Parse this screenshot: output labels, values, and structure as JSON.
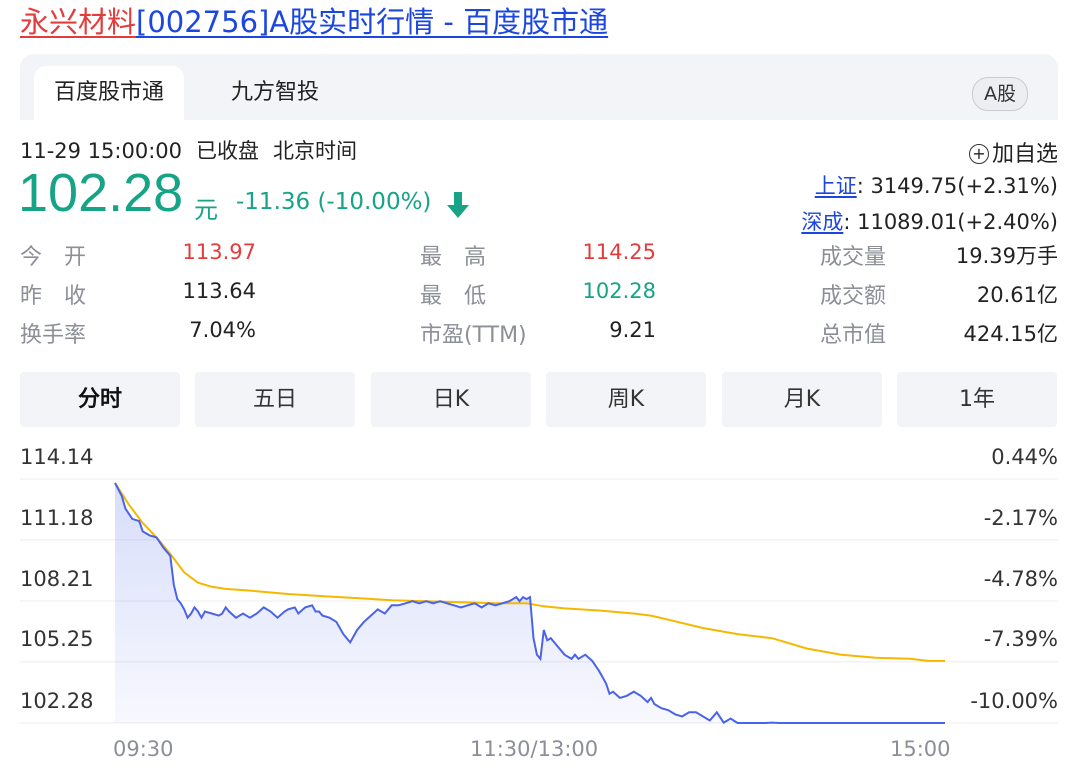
{
  "header": {
    "stock_name": "永兴材料",
    "code_title": "[002756]A股实时行情 - 百度股市通"
  },
  "tabs": {
    "items": [
      "百度股市通",
      "九方智投"
    ],
    "badge": "A股"
  },
  "quote": {
    "time": "11-29 15:00:00",
    "status": "已收盘",
    "timezone": "北京时间",
    "price": "102.28",
    "unit": "元",
    "change": "-11.36 (-10.00%)",
    "watch_label": "加自选",
    "watch_symbol": "+",
    "index_sh": {
      "name": "上证",
      "value": ": 3149.75(+2.31%)"
    },
    "index_sz": {
      "name": "深成",
      "value": ": 11089.01(+2.40%)"
    }
  },
  "stats": [
    {
      "label": "今　开",
      "value": "113.97",
      "color": "red"
    },
    {
      "label": "最　高",
      "value": "114.25",
      "color": "red"
    },
    {
      "label": "成交量",
      "value": "19.39万手",
      "color": ""
    },
    {
      "label": "昨　收",
      "value": "113.64",
      "color": ""
    },
    {
      "label": "最　低",
      "value": "102.28",
      "color": "green"
    },
    {
      "label": "成交额",
      "value": "20.61亿",
      "color": ""
    },
    {
      "label": "换手率",
      "value": "7.04%",
      "color": ""
    },
    {
      "label": "市盈(TTM)",
      "value": "9.21",
      "color": ""
    },
    {
      "label": "总市值",
      "value": "424.15亿",
      "color": ""
    }
  ],
  "period_tabs": [
    "分时",
    "五日",
    "日K",
    "周K",
    "月K",
    "1年"
  ],
  "colors": {
    "down": "#17a386",
    "up": "#e33c3c",
    "price_line": "#4a63e8",
    "avg_line": "#f5b800"
  },
  "chart_data": {
    "type": "line",
    "yticks_left": [
      "114.14",
      "111.18",
      "108.21",
      "105.25",
      "102.28"
    ],
    "yticks_right": [
      "0.44%",
      "-2.17%",
      "-4.78%",
      "-7.39%",
      "-10.00%"
    ],
    "xticks": [
      "09:30",
      "11:30/13:00",
      "15:00"
    ],
    "ylim": [
      102.28,
      114.14
    ],
    "x_minutes": [
      0,
      240
    ],
    "series": [
      {
        "x": [
          0,
          2,
          3,
          5,
          7,
          8,
          10,
          12,
          14,
          16,
          17,
          18,
          19,
          20,
          21,
          22,
          23,
          24,
          25,
          26,
          28,
          30,
          31,
          32,
          33,
          35,
          37,
          39,
          40,
          41,
          43,
          45,
          47,
          49,
          50,
          52,
          53,
          55,
          57,
          58,
          59,
          60,
          62,
          64,
          66,
          68,
          70,
          72,
          74,
          76,
          78,
          80,
          82,
          84,
          86,
          88,
          90,
          92,
          94,
          96,
          98,
          100,
          102,
          104,
          106,
          108,
          110,
          112,
          114,
          116,
          117,
          118,
          119,
          120,
          121,
          122,
          123,
          124,
          125,
          126,
          128,
          130,
          131,
          132,
          133,
          134,
          136,
          138,
          140,
          142,
          143,
          144,
          146,
          148,
          150,
          152,
          154,
          155,
          156,
          158,
          160,
          162,
          164,
          166,
          168,
          170,
          172,
          174,
          176,
          178,
          180,
          182,
          184,
          186,
          188,
          190,
          192,
          194,
          195,
          196,
          198,
          200,
          202,
          204,
          206,
          208,
          210,
          212,
          214,
          216,
          218,
          220,
          222,
          224,
          226,
          228,
          230,
          232,
          234,
          236,
          238,
          240
        ],
        "values": [
          113.95,
          113.3,
          112.7,
          112.2,
          112.1,
          111.6,
          111.4,
          111.3,
          110.8,
          110.4,
          109.0,
          108.3,
          108.1,
          107.8,
          107.4,
          107.6,
          107.9,
          107.7,
          107.4,
          107.7,
          107.6,
          107.5,
          107.6,
          107.9,
          107.7,
          107.4,
          107.6,
          107.4,
          107.5,
          107.6,
          107.9,
          107.7,
          107.4,
          107.7,
          107.8,
          107.9,
          107.6,
          107.9,
          108.0,
          107.7,
          107.7,
          107.5,
          107.4,
          107.2,
          106.6,
          106.2,
          106.8,
          107.2,
          107.5,
          107.8,
          107.6,
          108.0,
          108.0,
          108.1,
          108.2,
          108.1,
          108.2,
          108.1,
          108.2,
          108.1,
          108.0,
          107.9,
          108.0,
          108.1,
          107.9,
          108.1,
          108.0,
          108.1,
          108.2,
          108.4,
          108.2,
          108.4,
          108.3,
          108.4,
          106.4,
          105.6,
          105.4,
          106.8,
          106.3,
          106.4,
          106.0,
          105.6,
          105.5,
          105.4,
          105.6,
          105.4,
          105.6,
          105.3,
          104.8,
          104.2,
          103.7,
          103.8,
          103.5,
          103.6,
          103.8,
          103.6,
          103.3,
          103.5,
          103.2,
          103.0,
          102.9,
          102.7,
          102.6,
          102.8,
          102.8,
          102.6,
          102.4,
          102.8,
          102.3,
          102.5,
          102.28,
          102.28,
          102.28,
          102.28,
          102.28,
          102.3,
          102.28,
          102.28,
          102.28,
          102.28,
          102.28,
          102.28,
          102.28,
          102.28,
          102.28,
          102.28,
          102.28,
          102.28,
          102.28,
          102.28,
          102.28,
          102.28,
          102.28,
          102.28,
          102.28,
          102.28,
          102.28,
          102.28,
          102.28,
          102.28,
          102.28,
          102.28
        ]
      },
      {
        "x": [
          0,
          4,
          8,
          12,
          16,
          20,
          24,
          28,
          32,
          40,
          50,
          60,
          70,
          80,
          90,
          100,
          110,
          119,
          124,
          130,
          140,
          150,
          155,
          160,
          170,
          180,
          190,
          200,
          210,
          220,
          230,
          235,
          240
        ],
        "values": [
          113.95,
          112.9,
          112.0,
          111.3,
          110.5,
          109.6,
          109.1,
          108.9,
          108.8,
          108.7,
          108.55,
          108.45,
          108.35,
          108.25,
          108.2,
          108.15,
          108.1,
          108.1,
          107.95,
          107.85,
          107.75,
          107.6,
          107.5,
          107.3,
          106.9,
          106.6,
          106.4,
          105.9,
          105.6,
          105.45,
          105.4,
          105.3,
          105.3
        ]
      }
    ]
  }
}
